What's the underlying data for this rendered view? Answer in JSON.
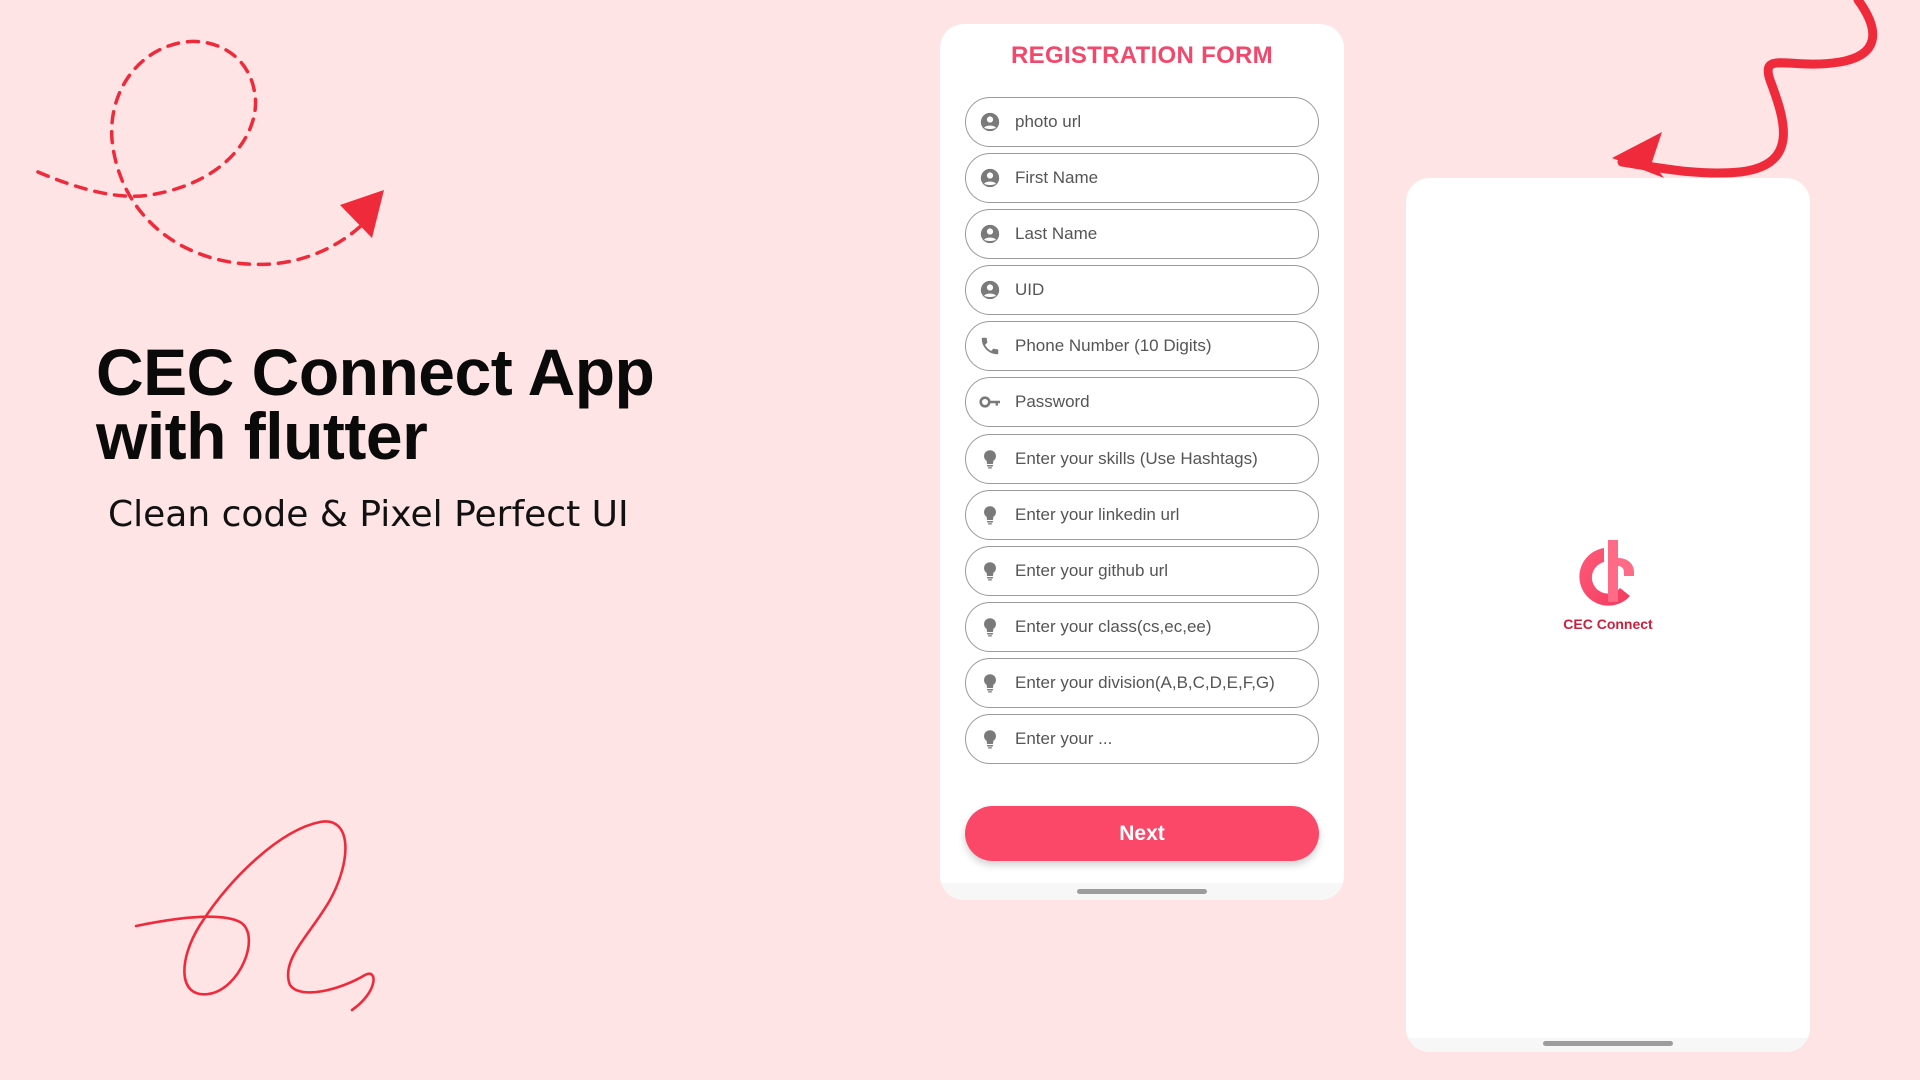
{
  "hero": {
    "title_line1": "CEC Connect App",
    "title_line2": "with flutter",
    "subtitle": "Clean code & Pixel Perfect UI"
  },
  "registration": {
    "title": "REGISTRATION FORM",
    "fields": [
      {
        "placeholder": "photo url",
        "icon": "person-icon"
      },
      {
        "placeholder": "First Name",
        "icon": "person-icon"
      },
      {
        "placeholder": "Last Name",
        "icon": "person-icon"
      },
      {
        "placeholder": "UID",
        "icon": "person-icon"
      },
      {
        "placeholder": "Phone Number (10 Digits)",
        "icon": "phone-icon"
      },
      {
        "placeholder": "Password",
        "icon": "key-icon"
      },
      {
        "placeholder": "Enter your skills (Use Hashtags)",
        "icon": "lightbulb-icon"
      },
      {
        "placeholder": "Enter your linkedin url",
        "icon": "lightbulb-icon"
      },
      {
        "placeholder": "Enter your github url",
        "icon": "lightbulb-icon"
      },
      {
        "placeholder": "Enter your class(cs,ec,ee)",
        "icon": "lightbulb-icon"
      },
      {
        "placeholder": "Enter your division(A,B,C,D,E,F,G)",
        "icon": "lightbulb-icon"
      },
      {
        "placeholder": "Enter your ...",
        "icon": "lightbulb-icon"
      }
    ],
    "next_label": "Next"
  },
  "splash": {
    "app_name": "CEC Connect"
  },
  "colors": {
    "background": "#ffe4e6",
    "accent": "#fb4869",
    "title_accent": "#f2486b",
    "doodle_red": "#ef2b3b"
  }
}
